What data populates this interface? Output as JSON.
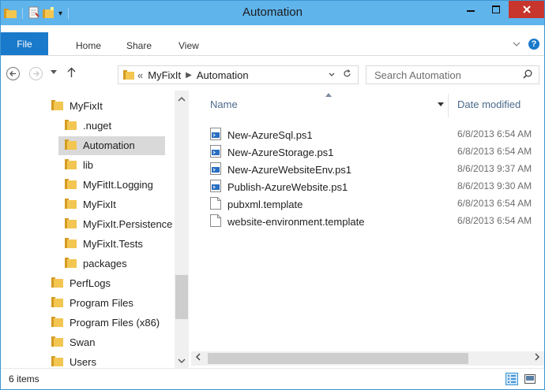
{
  "window": {
    "title": "Automation"
  },
  "ribbon": {
    "tabs": [
      "File",
      "Home",
      "Share",
      "View"
    ],
    "help": "?"
  },
  "address": {
    "prefix": "«",
    "crumbs": [
      "MyFixIt",
      "Automation"
    ]
  },
  "search": {
    "placeholder": "Search Automation"
  },
  "tree": [
    {
      "label": "MyFixIt",
      "level": 1,
      "selected": false
    },
    {
      "label": ".nuget",
      "level": 2,
      "selected": false
    },
    {
      "label": "Automation",
      "level": 2,
      "selected": true
    },
    {
      "label": "lib",
      "level": 2,
      "selected": false
    },
    {
      "label": "MyFitIt.Logging",
      "level": 2,
      "selected": false
    },
    {
      "label": "MyFixIt",
      "level": 2,
      "selected": false
    },
    {
      "label": "MyFixIt.Persistence",
      "level": 2,
      "selected": false
    },
    {
      "label": "MyFixIt.Tests",
      "level": 2,
      "selected": false
    },
    {
      "label": "packages",
      "level": 2,
      "selected": false
    },
    {
      "label": "PerfLogs",
      "level": 1,
      "selected": false
    },
    {
      "label": "Program Files",
      "level": 1,
      "selected": false
    },
    {
      "label": "Program Files (x86)",
      "level": 1,
      "selected": false
    },
    {
      "label": "Swan",
      "level": 1,
      "selected": false
    },
    {
      "label": "Users",
      "level": 1,
      "selected": false
    }
  ],
  "columns": {
    "name": "Name",
    "date": "Date modified"
  },
  "files": [
    {
      "name": "New-AzureSql.ps1",
      "date": "6/8/2013 6:54 AM",
      "icon": "powershell-script-icon"
    },
    {
      "name": "New-AzureStorage.ps1",
      "date": "6/8/2013 6:54 AM",
      "icon": "powershell-script-icon"
    },
    {
      "name": "New-AzureWebsiteEnv.ps1",
      "date": "8/6/2013 9:37 AM",
      "icon": "powershell-script-icon"
    },
    {
      "name": "Publish-AzureWebsite.ps1",
      "date": "8/6/2013 9:30 AM",
      "icon": "powershell-script-icon"
    },
    {
      "name": "pubxml.template",
      "date": "6/8/2013 6:54 AM",
      "icon": "blank-file-icon"
    },
    {
      "name": "website-environment.template",
      "date": "6/8/2013 6:54 AM",
      "icon": "blank-file-icon"
    }
  ],
  "status": {
    "item_count": "6 items"
  },
  "colors": {
    "titlebar": "#5fb4ec",
    "file_tab": "#1979ca",
    "close_button": "#c7352c",
    "folder": "#e8b33c",
    "selection": "#d9d9d9"
  }
}
